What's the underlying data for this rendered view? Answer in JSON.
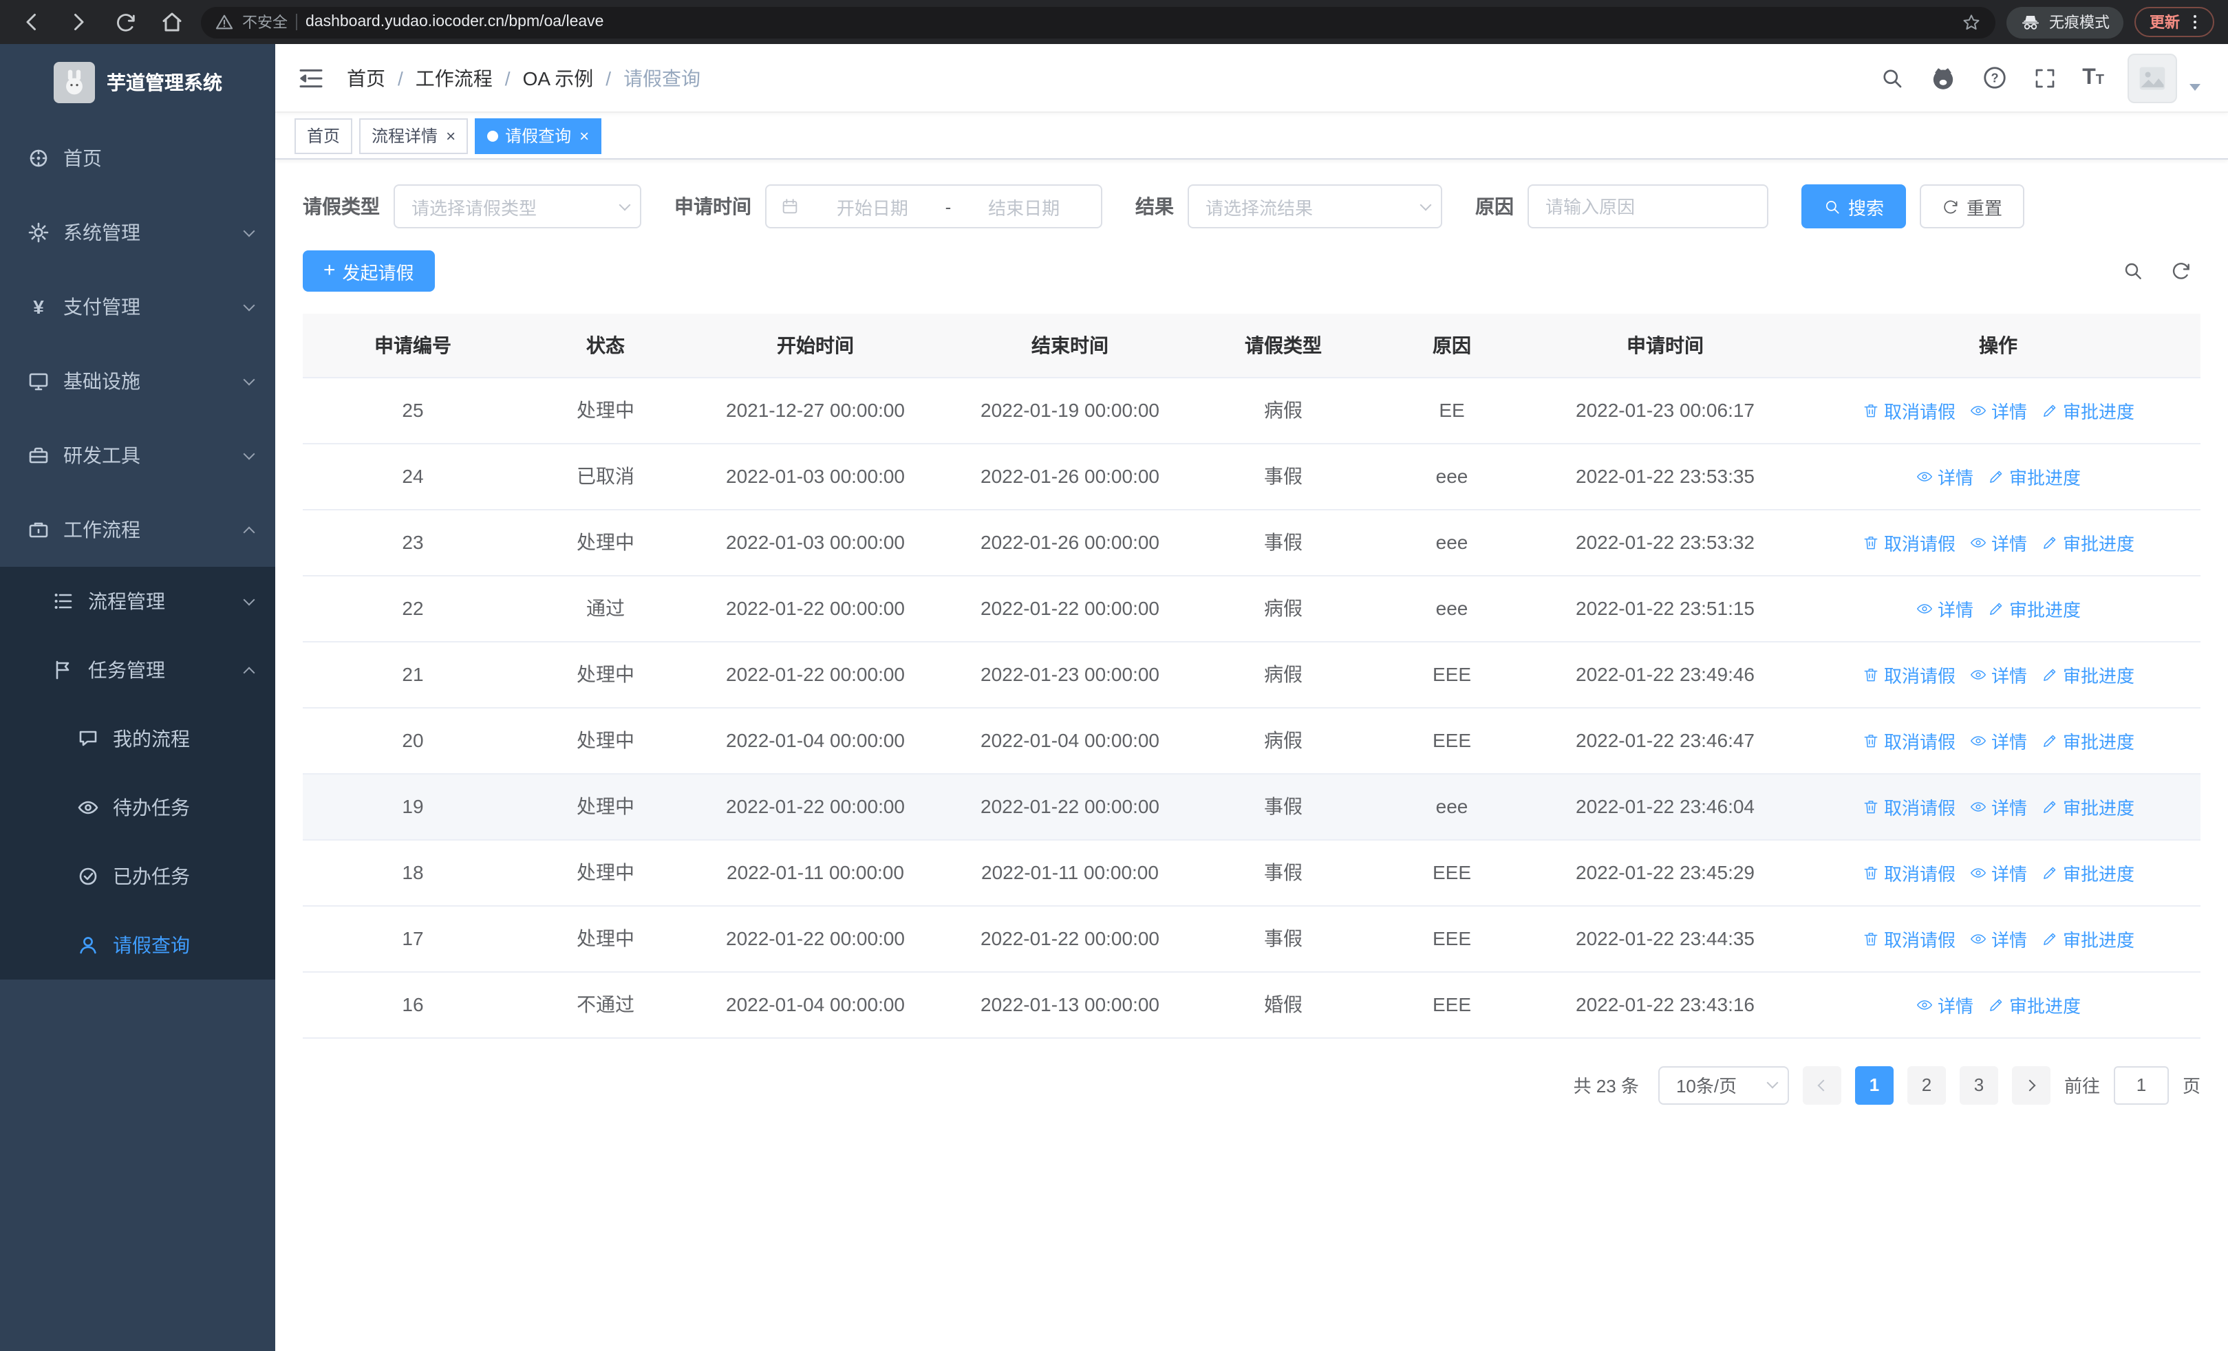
{
  "browser": {
    "security_label": "不安全",
    "url": "dashboard.yudao.iocoder.cn/bpm/oa/leave",
    "incognito_label": "无痕模式",
    "update_label": "更新"
  },
  "icons": {
    "yen": "¥",
    "help": "?",
    "font_size": "T",
    "close": "×",
    "plus": "+"
  },
  "colors": {
    "primary": "#409eff",
    "sidebar_bg": "#304156",
    "sidebar_sub": "#1f2d3d",
    "sidebar_text": "#bfcbd9"
  },
  "sidebar": {
    "title": "芋道管理系统",
    "items": [
      {
        "label": "首页"
      },
      {
        "label": "系统管理"
      },
      {
        "label": "支付管理"
      },
      {
        "label": "基础设施"
      },
      {
        "label": "研发工具"
      },
      {
        "label": "工作流程"
      },
      {
        "label": "流程管理"
      },
      {
        "label": "任务管理"
      },
      {
        "label": "我的流程"
      },
      {
        "label": "待办任务"
      },
      {
        "label": "已办任务"
      },
      {
        "label": "请假查询"
      }
    ]
  },
  "header": {
    "breadcrumb": [
      "首页",
      "工作流程",
      "OA 示例",
      "请假查询"
    ],
    "breadcrumb_separator": "/"
  },
  "tabs": [
    {
      "label": "首页"
    },
    {
      "label": "流程详情"
    },
    {
      "label": "请假查询"
    }
  ],
  "filters": {
    "leave_type_label": "请假类型",
    "leave_type_placeholder": "请选择请假类型",
    "apply_time_label": "申请时间",
    "start_date_placeholder": "开始日期",
    "date_separator": "-",
    "end_date_placeholder": "结束日期",
    "result_label": "结果",
    "result_placeholder": "请选择流结果",
    "reason_label": "原因",
    "reason_placeholder": "请输入原因",
    "search_button": "搜索",
    "reset_button": "重置"
  },
  "toolbar": {
    "create_button": "发起请假"
  },
  "table": {
    "columns": [
      "申请编号",
      "状态",
      "开始时间",
      "结束时间",
      "请假类型",
      "原因",
      "申请时间",
      "操作"
    ],
    "action_labels": {
      "cancel": "取消请假",
      "detail": "详情",
      "progress": "审批进度"
    },
    "rows": [
      {
        "id": "25",
        "status": "处理中",
        "start": "2021-12-27 00:00:00",
        "end": "2022-01-19 00:00:00",
        "type": "病假",
        "reason": "EE",
        "applied": "2022-01-23 00:06:17",
        "actions": [
          "cancel",
          "detail",
          "progress"
        ]
      },
      {
        "id": "24",
        "status": "已取消",
        "start": "2022-01-03 00:00:00",
        "end": "2022-01-26 00:00:00",
        "type": "事假",
        "reason": "eee",
        "applied": "2022-01-22 23:53:35",
        "actions": [
          "detail",
          "progress"
        ]
      },
      {
        "id": "23",
        "status": "处理中",
        "start": "2022-01-03 00:00:00",
        "end": "2022-01-26 00:00:00",
        "type": "事假",
        "reason": "eee",
        "applied": "2022-01-22 23:53:32",
        "actions": [
          "cancel",
          "detail",
          "progress"
        ]
      },
      {
        "id": "22",
        "status": "通过",
        "start": "2022-01-22 00:00:00",
        "end": "2022-01-22 00:00:00",
        "type": "病假",
        "reason": "eee",
        "applied": "2022-01-22 23:51:15",
        "actions": [
          "detail",
          "progress"
        ]
      },
      {
        "id": "21",
        "status": "处理中",
        "start": "2022-01-22 00:00:00",
        "end": "2022-01-23 00:00:00",
        "type": "病假",
        "reason": "EEE",
        "applied": "2022-01-22 23:49:46",
        "actions": [
          "cancel",
          "detail",
          "progress"
        ]
      },
      {
        "id": "20",
        "status": "处理中",
        "start": "2022-01-04 00:00:00",
        "end": "2022-01-04 00:00:00",
        "type": "病假",
        "reason": "EEE",
        "applied": "2022-01-22 23:46:47",
        "actions": [
          "cancel",
          "detail",
          "progress"
        ]
      },
      {
        "id": "19",
        "status": "处理中",
        "start": "2022-01-22 00:00:00",
        "end": "2022-01-22 00:00:00",
        "type": "事假",
        "reason": "eee",
        "applied": "2022-01-22 23:46:04",
        "actions": [
          "cancel",
          "detail",
          "progress"
        ],
        "highlight": true
      },
      {
        "id": "18",
        "status": "处理中",
        "start": "2022-01-11 00:00:00",
        "end": "2022-01-11 00:00:00",
        "type": "事假",
        "reason": "EEE",
        "applied": "2022-01-22 23:45:29",
        "actions": [
          "cancel",
          "detail",
          "progress"
        ]
      },
      {
        "id": "17",
        "status": "处理中",
        "start": "2022-01-22 00:00:00",
        "end": "2022-01-22 00:00:00",
        "type": "事假",
        "reason": "EEE",
        "applied": "2022-01-22 23:44:35",
        "actions": [
          "cancel",
          "detail",
          "progress"
        ]
      },
      {
        "id": "16",
        "status": "不通过",
        "start": "2022-01-04 00:00:00",
        "end": "2022-01-13 00:00:00",
        "type": "婚假",
        "reason": "EEE",
        "applied": "2022-01-22 23:43:16",
        "actions": [
          "detail",
          "progress"
        ]
      }
    ]
  },
  "pagination": {
    "total_text": "共 23 条",
    "page_size": "10条/页",
    "pages": [
      "1",
      "2",
      "3"
    ],
    "goto_label": "前往",
    "goto_value": "1",
    "goto_suffix": "页"
  }
}
